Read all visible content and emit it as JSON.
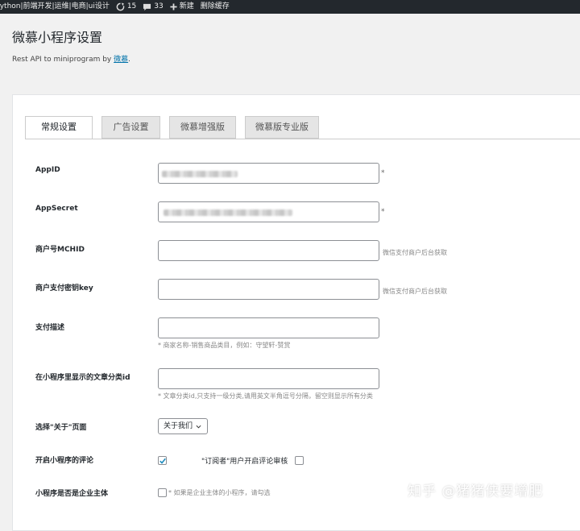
{
  "admin_bar": {
    "site": "python|前端开发|运维|电商|ui设计",
    "updates_count": "15",
    "comments_count": "33",
    "new_label": "新建",
    "clear_cache_label": "删除缓存"
  },
  "page": {
    "title": "微慕小程序设置",
    "subtitle_prefix": "Rest API to miniprogram by ",
    "subtitle_link": "微慕",
    "subtitle_suffix": "."
  },
  "tabs": [
    {
      "label": "常规设置",
      "active": true
    },
    {
      "label": "广告设置",
      "active": false
    },
    {
      "label": "微慕增强版",
      "active": false
    },
    {
      "label": "微慕版专业版",
      "active": false
    }
  ],
  "form": {
    "appid": {
      "label": "AppID",
      "required_mark": "*"
    },
    "appsecret": {
      "label": "AppSecret",
      "required_mark": "*"
    },
    "mchid": {
      "label": "商户号MCHID",
      "hint": "微信支付商户后台获取"
    },
    "paykey": {
      "label": "商户支付密钥key",
      "hint": "微信支付商户后台获取"
    },
    "paydesc": {
      "label": "支付描述",
      "hint": "* 商家名称-销售商品类目，例如：守望轩-赞赏"
    },
    "category": {
      "label": "在小程序里显示的文章分类id",
      "hint": "* 文章分类id,只支持一级分类,请用英文半角逗号分隔，留空则显示所有分类"
    },
    "about": {
      "label": "选择\"关于\"页面",
      "selected": "关于我们"
    },
    "comments": {
      "label": "开启小程序的评论",
      "checked": true,
      "subscriber_label": "\"订阅者\"用户开启评论审核",
      "subscriber_checked": false
    },
    "enterprise": {
      "label": "小程序是否是企业主体",
      "hint": "* 如果是企业主体的小程序，请勾选",
      "checked": false
    }
  },
  "watermark": "知乎 @猪猪侠要增肥",
  "colors": {
    "admin_bar": "#23282d",
    "link": "#0073aa",
    "checkbox": "#1e8cbe"
  }
}
